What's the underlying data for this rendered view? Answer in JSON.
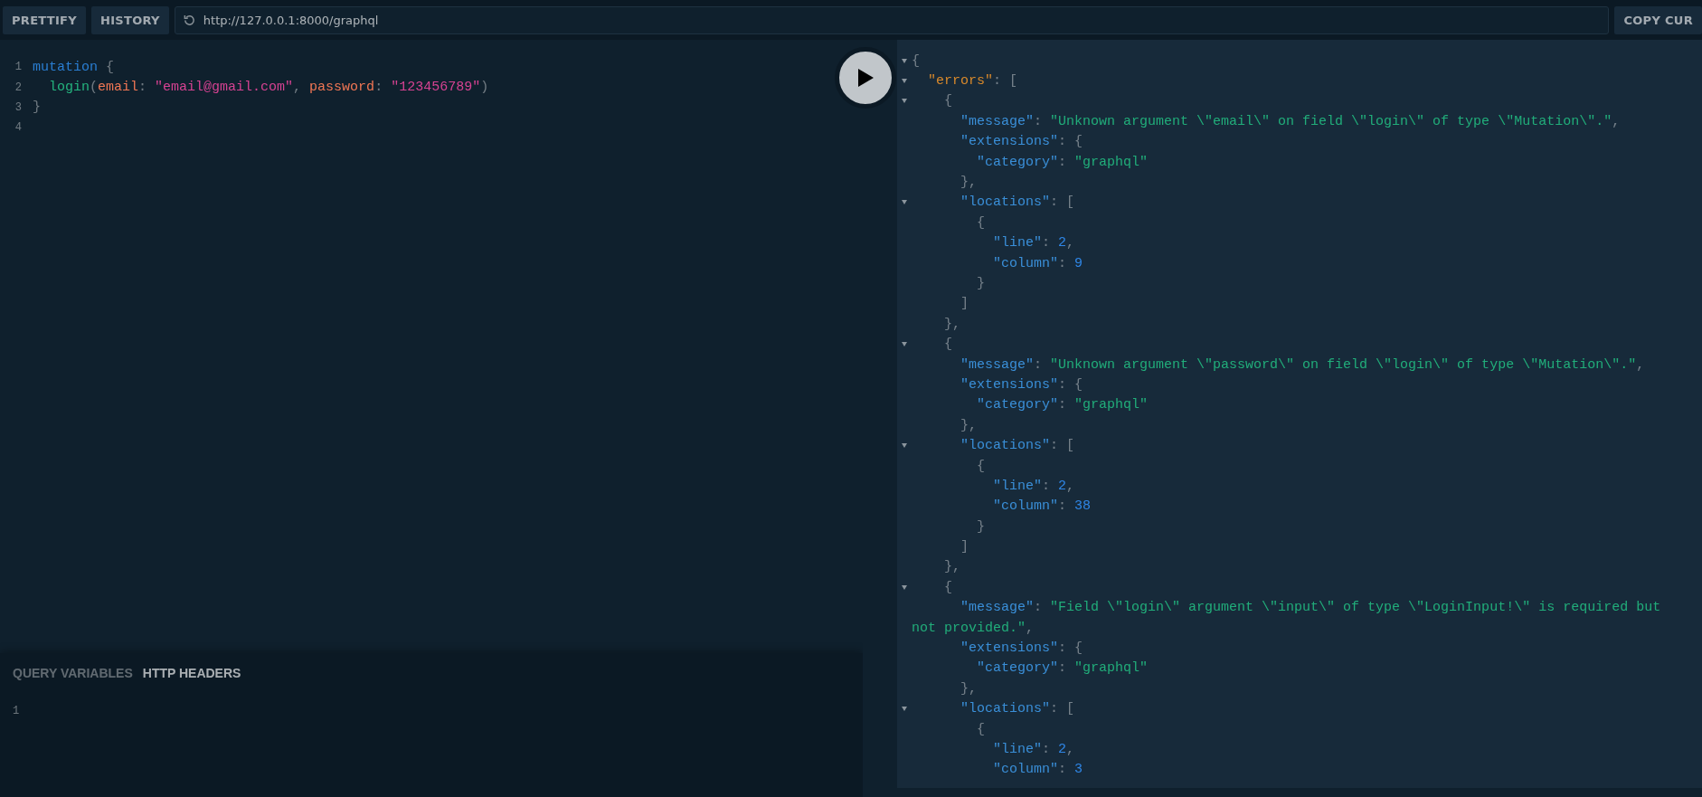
{
  "toolbar": {
    "buttons": [
      "PRETTIFY",
      "HISTORY"
    ],
    "url": "http://127.0.0.1:8000/graphql",
    "copy_button": "COPY CUR"
  },
  "editor": {
    "lines": [
      {
        "number": "1",
        "tokens": [
          {
            "kind": "keyword",
            "text": "mutation"
          },
          {
            "kind": "punct",
            "text": " {"
          }
        ]
      },
      {
        "number": "2",
        "tokens": [
          {
            "kind": "field",
            "text": "  login"
          },
          {
            "kind": "punct",
            "text": "("
          },
          {
            "kind": "attr",
            "text": "email"
          },
          {
            "kind": "punct",
            "text": ": "
          },
          {
            "kind": "string",
            "text": "\"email@gmail.com\""
          },
          {
            "kind": "punct",
            "text": ", "
          },
          {
            "kind": "attr",
            "text": "password"
          },
          {
            "kind": "punct",
            "text": ": "
          },
          {
            "kind": "string",
            "text": "\"123456789\""
          },
          {
            "kind": "punct",
            "text": ")"
          }
        ]
      },
      {
        "number": "3",
        "tokens": [
          {
            "kind": "punct",
            "text": "}"
          }
        ]
      },
      {
        "number": "4"
      }
    ]
  },
  "bottom_panel": {
    "tabs": [
      {
        "label": "QUERY VARIABLES",
        "selected": false
      },
      {
        "label": "HTTP HEADERS",
        "selected": true
      }
    ],
    "lines": [
      "1"
    ]
  },
  "response": {
    "lines": [
      {
        "fold": true,
        "tokens": [
          {
            "kind": "punct",
            "text": "{"
          }
        ]
      },
      {
        "fold": true,
        "tokens": [
          {
            "kind": "errkey",
            "text": "  \"errors\""
          },
          {
            "kind": "punct",
            "text": ": ["
          }
        ]
      },
      {
        "fold": true,
        "tokens": [
          {
            "kind": "punct",
            "text": "    {"
          }
        ]
      },
      {
        "fold": false,
        "tokens": [
          {
            "kind": "key",
            "text": "      \"message\""
          },
          {
            "kind": "punct",
            "text": ": "
          },
          {
            "kind": "string",
            "text": "\"Unknown argument \\\"email\\\" on field \\\"login\\\" of type \\\"Mutation\\\".\""
          },
          {
            "kind": "punct",
            "text": ","
          }
        ]
      },
      {
        "fold": false,
        "tokens": [
          {
            "kind": "key",
            "text": "      \"extensions\""
          },
          {
            "kind": "punct",
            "text": ": {"
          }
        ]
      },
      {
        "fold": false,
        "tokens": [
          {
            "kind": "key",
            "text": "        \"category\""
          },
          {
            "kind": "punct",
            "text": ": "
          },
          {
            "kind": "string",
            "text": "\"graphql\""
          }
        ]
      },
      {
        "fold": false,
        "tokens": [
          {
            "kind": "punct",
            "text": "      },"
          }
        ]
      },
      {
        "fold": true,
        "tokens": [
          {
            "kind": "key",
            "text": "      \"locations\""
          },
          {
            "kind": "punct",
            "text": ": ["
          }
        ]
      },
      {
        "fold": false,
        "tokens": [
          {
            "kind": "punct",
            "text": "        {"
          }
        ]
      },
      {
        "fold": false,
        "tokens": [
          {
            "kind": "key",
            "text": "          \"line\""
          },
          {
            "kind": "punct",
            "text": ": "
          },
          {
            "kind": "number",
            "text": "2"
          },
          {
            "kind": "punct",
            "text": ","
          }
        ]
      },
      {
        "fold": false,
        "tokens": [
          {
            "kind": "key",
            "text": "          \"column\""
          },
          {
            "kind": "punct",
            "text": ": "
          },
          {
            "kind": "number",
            "text": "9"
          }
        ]
      },
      {
        "fold": false,
        "tokens": [
          {
            "kind": "punct",
            "text": "        }"
          }
        ]
      },
      {
        "fold": false,
        "tokens": [
          {
            "kind": "punct",
            "text": "      ]"
          }
        ]
      },
      {
        "fold": false,
        "tokens": [
          {
            "kind": "punct",
            "text": "    },"
          }
        ]
      },
      {
        "fold": true,
        "tokens": [
          {
            "kind": "punct",
            "text": "    {"
          }
        ]
      },
      {
        "fold": false,
        "tokens": [
          {
            "kind": "key",
            "text": "      \"message\""
          },
          {
            "kind": "punct",
            "text": ": "
          },
          {
            "kind": "string",
            "text": "\"Unknown argument \\\"password\\\" on field \\\"login\\\" of type \\\"Mutation\\\".\""
          },
          {
            "kind": "punct",
            "text": ","
          }
        ]
      },
      {
        "fold": false,
        "tokens": [
          {
            "kind": "key",
            "text": "      \"extensions\""
          },
          {
            "kind": "punct",
            "text": ": {"
          }
        ]
      },
      {
        "fold": false,
        "tokens": [
          {
            "kind": "key",
            "text": "        \"category\""
          },
          {
            "kind": "punct",
            "text": ": "
          },
          {
            "kind": "string",
            "text": "\"graphql\""
          }
        ]
      },
      {
        "fold": false,
        "tokens": [
          {
            "kind": "punct",
            "text": "      },"
          }
        ]
      },
      {
        "fold": true,
        "tokens": [
          {
            "kind": "key",
            "text": "      \"locations\""
          },
          {
            "kind": "punct",
            "text": ": ["
          }
        ]
      },
      {
        "fold": false,
        "tokens": [
          {
            "kind": "punct",
            "text": "        {"
          }
        ]
      },
      {
        "fold": false,
        "tokens": [
          {
            "kind": "key",
            "text": "          \"line\""
          },
          {
            "kind": "punct",
            "text": ": "
          },
          {
            "kind": "number",
            "text": "2"
          },
          {
            "kind": "punct",
            "text": ","
          }
        ]
      },
      {
        "fold": false,
        "tokens": [
          {
            "kind": "key",
            "text": "          \"column\""
          },
          {
            "kind": "punct",
            "text": ": "
          },
          {
            "kind": "number",
            "text": "38"
          }
        ]
      },
      {
        "fold": false,
        "tokens": [
          {
            "kind": "punct",
            "text": "        }"
          }
        ]
      },
      {
        "fold": false,
        "tokens": [
          {
            "kind": "punct",
            "text": "      ]"
          }
        ]
      },
      {
        "fold": false,
        "tokens": [
          {
            "kind": "punct",
            "text": "    },"
          }
        ]
      },
      {
        "fold": true,
        "tokens": [
          {
            "kind": "punct",
            "text": "    {"
          }
        ]
      },
      {
        "fold": false,
        "tokens": [
          {
            "kind": "key",
            "text": "      \"message\""
          },
          {
            "kind": "punct",
            "text": ": "
          },
          {
            "kind": "string",
            "text": "\"Field \\\"login\\\" argument \\\"input\\\" of type \\\"LoginInput!\\\" is required but"
          }
        ]
      },
      {
        "fold": false,
        "tokens": [
          {
            "kind": "string",
            "text": "not provided.\""
          },
          {
            "kind": "punct",
            "text": ","
          }
        ]
      },
      {
        "fold": false,
        "tokens": [
          {
            "kind": "key",
            "text": "      \"extensions\""
          },
          {
            "kind": "punct",
            "text": ": {"
          }
        ]
      },
      {
        "fold": false,
        "tokens": [
          {
            "kind": "key",
            "text": "        \"category\""
          },
          {
            "kind": "punct",
            "text": ": "
          },
          {
            "kind": "string",
            "text": "\"graphql\""
          }
        ]
      },
      {
        "fold": false,
        "tokens": [
          {
            "kind": "punct",
            "text": "      },"
          }
        ]
      },
      {
        "fold": true,
        "tokens": [
          {
            "kind": "key",
            "text": "      \"locations\""
          },
          {
            "kind": "punct",
            "text": ": ["
          }
        ]
      },
      {
        "fold": false,
        "tokens": [
          {
            "kind": "punct",
            "text": "        {"
          }
        ]
      },
      {
        "fold": false,
        "tokens": [
          {
            "kind": "key",
            "text": "          \"line\""
          },
          {
            "kind": "punct",
            "text": ": "
          },
          {
            "kind": "number",
            "text": "2"
          },
          {
            "kind": "punct",
            "text": ","
          }
        ]
      },
      {
        "fold": false,
        "tokens": [
          {
            "kind": "key",
            "text": "          \"column\""
          },
          {
            "kind": "punct",
            "text": ": "
          },
          {
            "kind": "number",
            "text": "3"
          }
        ]
      }
    ]
  }
}
